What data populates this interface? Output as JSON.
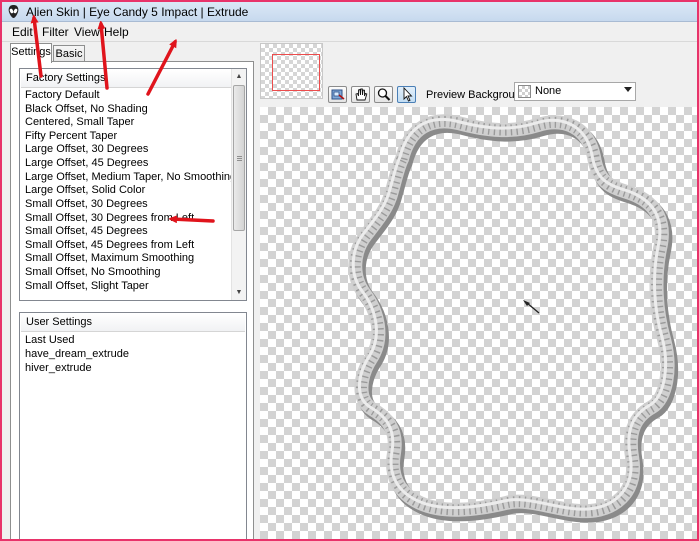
{
  "window": {
    "title": "Alien Skin | Eye Candy 5 Impact | Extrude",
    "app_icon": "alien-skin-icon",
    "border_color": "#e8336a"
  },
  "menu": {
    "items": [
      "Edit",
      "Filter",
      "View",
      "Help"
    ]
  },
  "tabs": {
    "settings_label": "Settings",
    "basic_label": "Basic",
    "active": "Settings"
  },
  "factory_settings": {
    "header": "Factory Settings",
    "items": [
      "Factory Default",
      "Black Offset, No Shading",
      "Centered, Small Taper",
      "Fifty Percent Taper",
      "Large Offset, 30 Degrees",
      "Large Offset, 45 Degrees",
      "Large Offset, Medium Taper, No Smoothing",
      "Large Offset, Solid Color",
      "Small Offset, 30 Degrees",
      "Small Offset, 30 Degrees from Left",
      "Small Offset, 45 Degrees",
      "Small Offset, 45 Degrees from Left",
      "Small Offset, Maximum Smoothing",
      "Small Offset, No Smoothing",
      "Small Offset, Slight Taper"
    ]
  },
  "user_settings": {
    "header": "User Settings",
    "items": [
      "Last Used",
      "have_dream_extrude",
      "hiver_extrude"
    ]
  },
  "preview_toolbar": {
    "tools": [
      "preview-navigate-icon",
      "hand-icon",
      "zoom-icon",
      "arrow-cursor-icon"
    ],
    "active_tool": "arrow-cursor-icon",
    "background_label": "Preview Background:",
    "background_value": "None"
  },
  "annotations": {
    "arrow_color": "#e0141c",
    "arrows": [
      "title-app-name",
      "menu-filter",
      "menu-help",
      "factory-settings-header",
      "list-item-small-offset-30-from-left"
    ]
  }
}
